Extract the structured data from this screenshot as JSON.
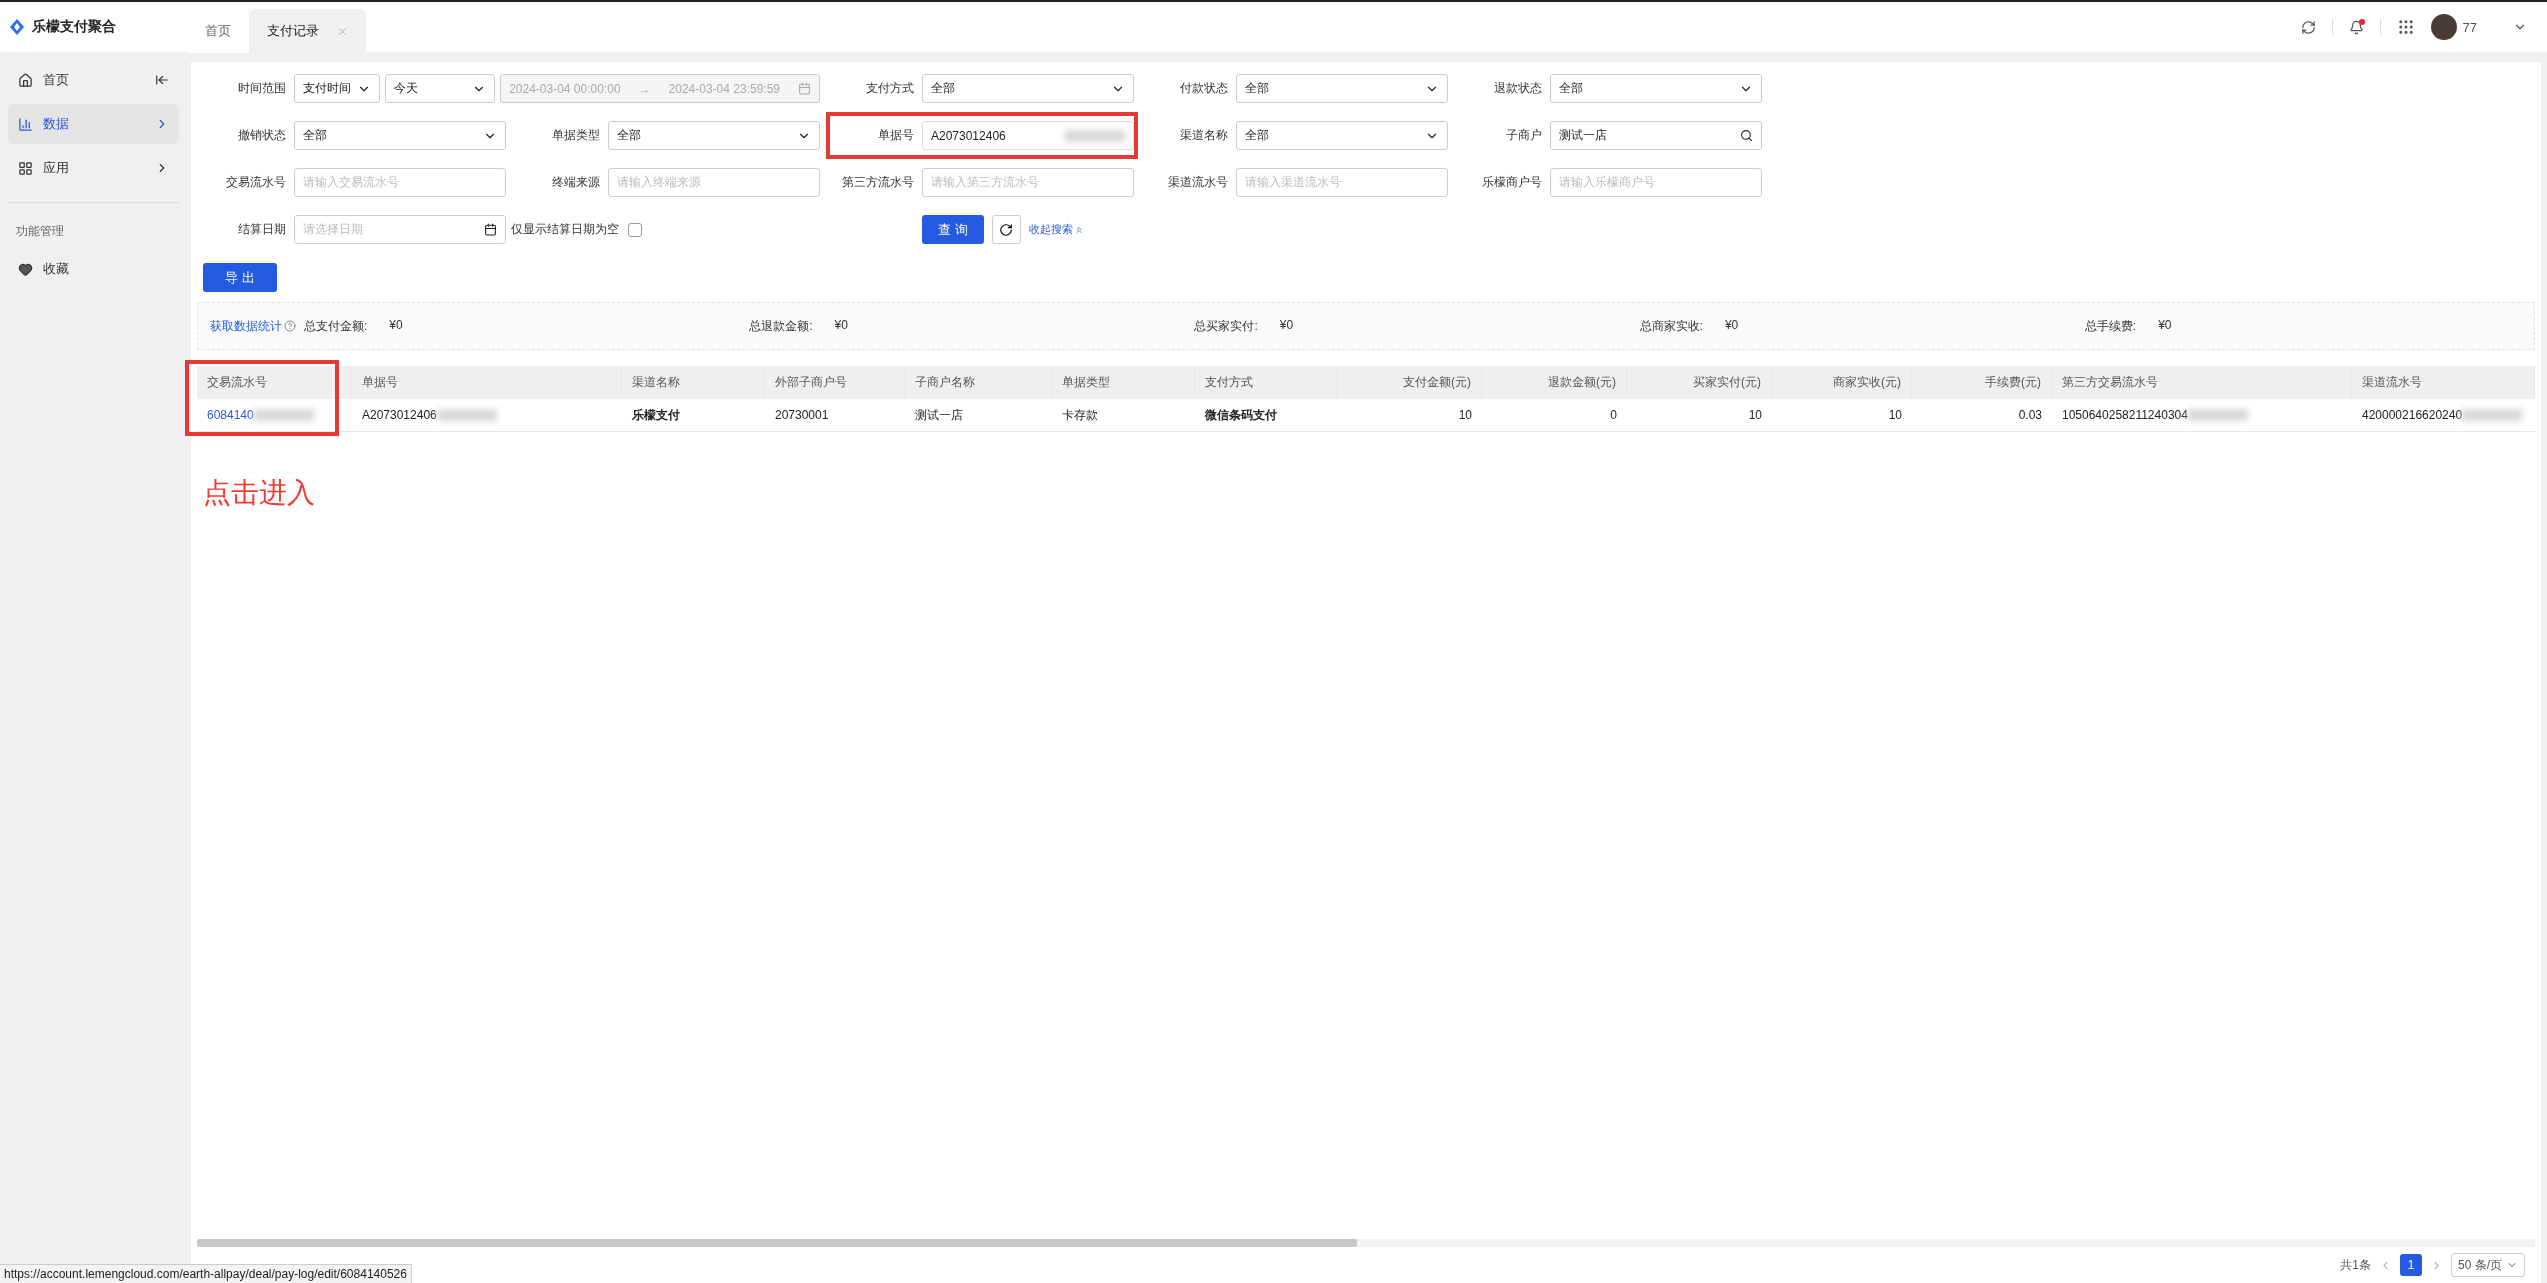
{
  "app": {
    "title": "乐檬支付聚合"
  },
  "tabs": [
    {
      "label": "首页",
      "selected": false,
      "closable": false
    },
    {
      "label": "支付记录",
      "selected": true,
      "closable": true
    }
  ],
  "header": {
    "user": "77",
    "notification": true
  },
  "sidebar": {
    "items": [
      {
        "label": "首页",
        "selected": false,
        "expandable": false,
        "collapse": true
      },
      {
        "label": "数据",
        "selected": true,
        "expandable": true,
        "collapse": false
      },
      {
        "label": "应用",
        "selected": false,
        "expandable": true,
        "collapse": false
      }
    ],
    "group": "功能管理",
    "extra": [
      {
        "label": "收藏"
      }
    ]
  },
  "filters": [
    [
      {
        "label": "时间范围",
        "kind": "daterange",
        "mode": "支付时间",
        "preset": "今天",
        "start": "2024-03-04 00:00:00",
        "arrow": "→",
        "end": "2024-03-04 23:59:59"
      },
      {
        "label": "支付方式",
        "kind": "select",
        "value": "全部"
      },
      {
        "label": "付款状态",
        "kind": "select",
        "value": "全部"
      },
      {
        "label": "退款状态",
        "kind": "select",
        "value": "全部"
      }
    ],
    [
      {
        "label": "撤销状态",
        "kind": "select",
        "value": "全部"
      },
      {
        "label": "单据类型",
        "kind": "select",
        "value": "全部"
      },
      {
        "label": "单据号",
        "kind": "input",
        "value": "A2073012406",
        "highlighted": true
      },
      {
        "label": "渠道名称",
        "kind": "select",
        "value": "全部"
      },
      {
        "label": "子商户",
        "kind": "search",
        "value": "测试一店"
      }
    ],
    [
      {
        "label": "交易流水号",
        "kind": "input",
        "placeholder": "请输入交易流水号"
      },
      {
        "label": "终端来源",
        "kind": "input",
        "placeholder": "请输入终端来源"
      },
      {
        "label": "第三方流水号",
        "kind": "input",
        "placeholder": "请输入第三方流水号"
      },
      {
        "label": "渠道流水号",
        "kind": "input",
        "placeholder": "请输入渠道流水号"
      },
      {
        "label": "乐檬商户号",
        "kind": "input",
        "placeholder": "请输入乐檬商户号"
      }
    ],
    [
      {
        "label": "结算日期",
        "kind": "date",
        "placeholder": "请选择日期"
      },
      {
        "label": "仅显示结算日期为空",
        "kind": "checkbox",
        "checked": false
      },
      {
        "kind": "actions",
        "search": "查 询",
        "collapse": "收起搜索"
      }
    ]
  ],
  "export_button": "导 出",
  "stats": {
    "link": "获取数据统计",
    "items": [
      {
        "label": "总支付金额:",
        "value": "¥0"
      },
      {
        "label": "总退款金额:",
        "value": "¥0"
      },
      {
        "label": "总买家实付:",
        "value": "¥0"
      },
      {
        "label": "总商家实收:",
        "value": "¥0"
      },
      {
        "label": "总手续费:",
        "value": "¥0"
      }
    ]
  },
  "table": {
    "columns": [
      {
        "label": "交易流水号",
        "kind": "text",
        "highlighted": true
      },
      {
        "label": "单据号",
        "kind": "text"
      },
      {
        "label": "渠道名称",
        "kind": "text"
      },
      {
        "label": "外部子商户号",
        "kind": "text"
      },
      {
        "label": "子商户名称",
        "kind": "text"
      },
      {
        "label": "单据类型",
        "kind": "text"
      },
      {
        "label": "支付方式",
        "kind": "text"
      },
      {
        "label": "支付金额(元)",
        "kind": "amount"
      },
      {
        "label": "退款金额(元)",
        "kind": "amount"
      },
      {
        "label": "买家实付(元)",
        "kind": "amount"
      },
      {
        "label": "商家实收(元)",
        "kind": "amount"
      },
      {
        "label": "手续费(元)",
        "kind": "amount"
      },
      {
        "label": "第三方交易流水号",
        "kind": "text"
      },
      {
        "label": "渠道流水号",
        "kind": "text"
      }
    ],
    "rows": [
      {
        "cells": [
          {
            "text": "6084140",
            "link": true,
            "blurred": true
          },
          {
            "text": "A2073012406",
            "blurred": true
          },
          {
            "text": "乐檬支付",
            "bold": true
          },
          {
            "text": "20730001"
          },
          {
            "text": "测试一店"
          },
          {
            "text": "卡存款"
          },
          {
            "text": "微信条码支付",
            "bold": true
          },
          {
            "text": "10"
          },
          {
            "text": "0"
          },
          {
            "text": "10"
          },
          {
            "text": "10"
          },
          {
            "text": "0.03"
          },
          {
            "text": "1050640258211240304",
            "blurred": true
          },
          {
            "text": "420000216620240",
            "blurred": true
          }
        ]
      }
    ]
  },
  "annotation": "点击进入",
  "pagination": {
    "total": "共1条",
    "pages": [
      {
        "label": "1",
        "selected": true
      }
    ],
    "page_size": "50 条/页"
  },
  "status_url": "https://account.lemengcloud.com/earth-allpay/deal/pay-log/edit/6084140526"
}
